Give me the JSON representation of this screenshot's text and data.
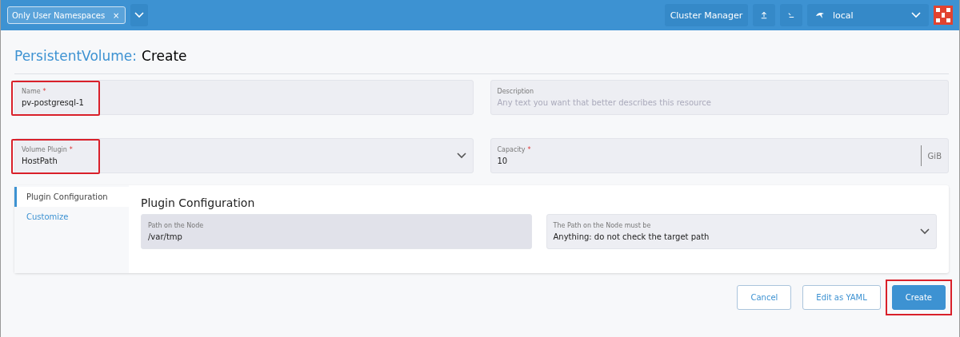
{
  "header": {
    "namespace_filter": {
      "tag": "Only User Namespaces",
      "remove": "×"
    },
    "cluster_manager": "Cluster Manager",
    "cluster": {
      "name": "local"
    }
  },
  "title": {
    "kind_label": "PersistentVolume:",
    "action": "Create"
  },
  "fields": [
    {
      "kind": "text",
      "label": "Name",
      "required_mark": "*",
      "value": "pv-postgresql-1",
      "highlighted": true
    },
    {
      "kind": "text",
      "label": "Description",
      "placeholder": "Any text you want that better describes this resource",
      "highlighted": false
    },
    {
      "kind": "select",
      "label": "Volume Plugin",
      "required_mark": "*",
      "value": "HostPath",
      "highlighted": true
    },
    {
      "kind": "unit",
      "label": "Capacity",
      "required_mark": "*",
      "value": "10",
      "unit": "GiB",
      "highlighted": false
    }
  ],
  "side_tabs": [
    {
      "label": "Plugin Configuration",
      "selected": true
    },
    {
      "label": "Customize",
      "selected": false
    }
  ],
  "plugin": {
    "heading": "Plugin Configuration",
    "fields": [
      {
        "kind": "text",
        "label": "Path on the Node",
        "value": "/var/tmp",
        "focused": true
      },
      {
        "kind": "select",
        "label": "The Path on the Node must be",
        "value": "Anything: do not check the target path",
        "focused": false
      }
    ]
  },
  "buttons": [
    {
      "label": "Cancel",
      "primary": false,
      "highlighted": false
    },
    {
      "label": "Edit as YAML",
      "primary": false,
      "highlighted": false
    },
    {
      "label": "Create",
      "primary": true,
      "highlighted": true
    }
  ]
}
